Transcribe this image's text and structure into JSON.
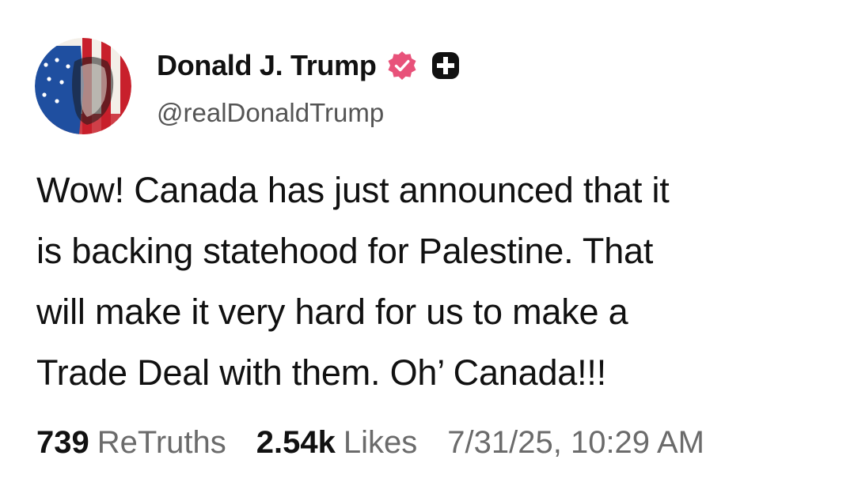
{
  "author": {
    "display_name": "Donald J. Trump",
    "handle": "@realDonaldTrump",
    "avatar_icon": "flag-portrait-avatar",
    "verified_icon": "verified-badge-icon",
    "plus_icon": "plus-badge-icon",
    "verified_color": "#e8527a"
  },
  "post": {
    "lines": [
      "Wow! Canada has just announced that it",
      "is backing statehood for Palestine. That",
      "will make it very hard for us to make a",
      "Trade Deal with them. Oh’ Canada!!!"
    ]
  },
  "stats": {
    "retruths_count": "739",
    "retruths_label": "ReTruths",
    "likes_count": "2.54k",
    "likes_label": "Likes",
    "timestamp": "7/31/25, 10:29 AM"
  }
}
